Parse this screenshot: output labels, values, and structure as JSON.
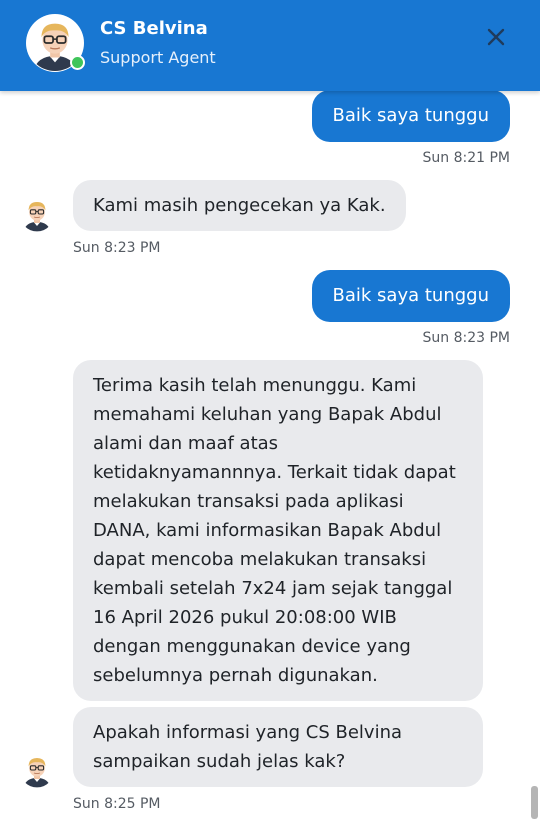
{
  "header": {
    "agent_name": "CS Belvina",
    "agent_role": "Support Agent",
    "close_icon": "close-icon",
    "online_status_color": "#3fc55a",
    "brand_color": "#1877d2"
  },
  "messages": [
    {
      "from": "user",
      "text": "Baik saya tunggu",
      "time": "Sun 8:21 PM"
    },
    {
      "from": "agent",
      "text": "Kami masih pengecekan ya Kak.",
      "time": "Sun 8:23 PM"
    },
    {
      "from": "user",
      "text": "Baik saya tunggu",
      "time": "Sun 8:23 PM"
    },
    {
      "from": "agent",
      "lines": [
        "Terima kasih telah menunggu. Kami",
        "memahami keluhan yang Bapak Abdul",
        "alami dan maaf atas",
        "ketidaknyamannnya. Terkait tidak dapat",
        "melakukan transaksi pada aplikasi",
        "DANA, kami informasikan Bapak Abdul",
        "dapat mencoba melakukan transaksi",
        "kembali setelah 7x24 jam sejak tanggal",
        "16 April 2026 pukul 20:08:00 WIB",
        "dengan menggunakan device yang",
        "sebelumnya pernah digunakan."
      ]
    },
    {
      "from": "agent",
      "lines": [
        "Apakah informasi yang CS Belvina",
        "sampaikan sudah jelas kak?"
      ],
      "time": "Sun 8:25 PM"
    }
  ]
}
